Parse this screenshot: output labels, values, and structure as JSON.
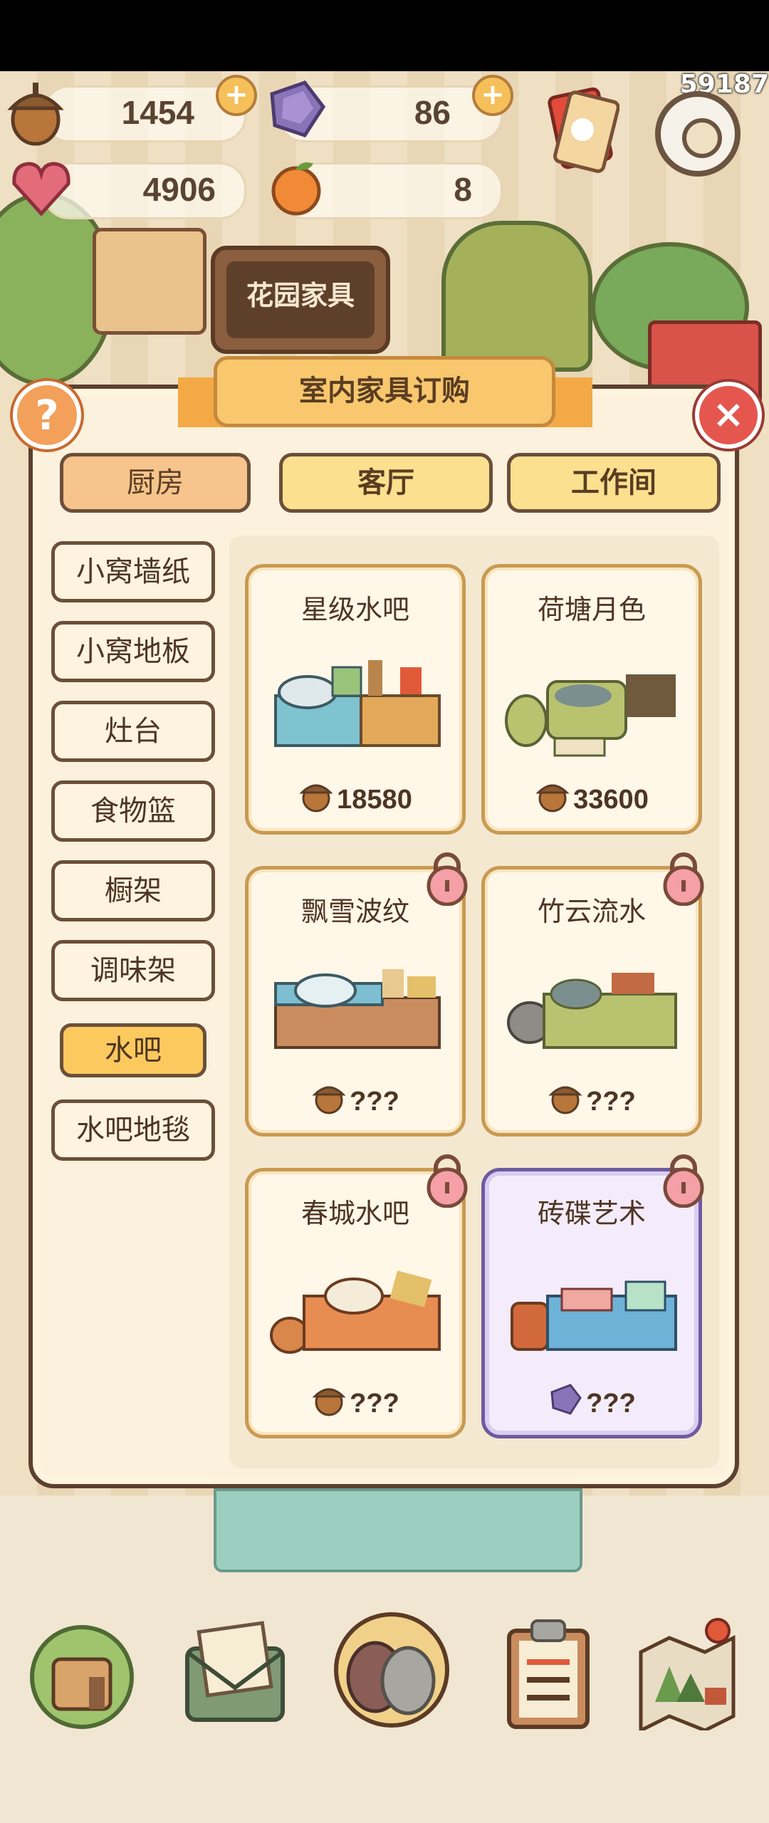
{
  "counter": "59187",
  "resources": [
    {
      "icon": "acorn-icon",
      "value": "1454",
      "has_plus": true
    },
    {
      "icon": "gem-icon",
      "value": "86",
      "has_plus": true
    },
    {
      "icon": "heart-gem-icon",
      "value": "4906",
      "has_plus": false
    },
    {
      "icon": "orange-icon",
      "value": "8",
      "has_plus": false
    }
  ],
  "background_sign": "花园家具",
  "dialog": {
    "title": "室内家具订购",
    "tabs": [
      {
        "label": "厨房",
        "active": true
      },
      {
        "label": "客厅",
        "active": false
      },
      {
        "label": "工作间",
        "active": false
      }
    ],
    "side_menu": [
      {
        "label": "小窝墙纸",
        "active": false
      },
      {
        "label": "小窝地板",
        "active": false
      },
      {
        "label": "灶台",
        "active": false
      },
      {
        "label": "食物篮",
        "active": false
      },
      {
        "label": "橱架",
        "active": false
      },
      {
        "label": "调味架",
        "active": false
      },
      {
        "label": "水吧",
        "active": true
      },
      {
        "label": "水吧地毯",
        "active": false
      }
    ],
    "items": [
      {
        "name": "星级水吧",
        "price": "18580",
        "currency": "acorn-icon",
        "locked": false
      },
      {
        "name": "荷塘月色",
        "price": "33600",
        "currency": "acorn-icon",
        "locked": false
      },
      {
        "name": "飘雪波纹",
        "price": "???",
        "currency": "acorn-icon",
        "locked": true
      },
      {
        "name": "竹云流水",
        "price": "???",
        "currency": "acorn-icon",
        "locked": true
      },
      {
        "name": "春城水吧",
        "price": "???",
        "currency": "acorn-icon",
        "locked": true
      },
      {
        "name": "砖碟艺术",
        "price": "???",
        "currency": "gem-icon",
        "locked": true,
        "special": true
      }
    ]
  },
  "bottom_nav": [
    "home-icon",
    "mail-icon",
    "paw-badge-icon",
    "clipboard-icon",
    "map-icon"
  ],
  "colors": {
    "accent": "#f8c76e",
    "close": "#e5574e",
    "special_card": "#6e5aa0",
    "frame": "#5c4130"
  }
}
